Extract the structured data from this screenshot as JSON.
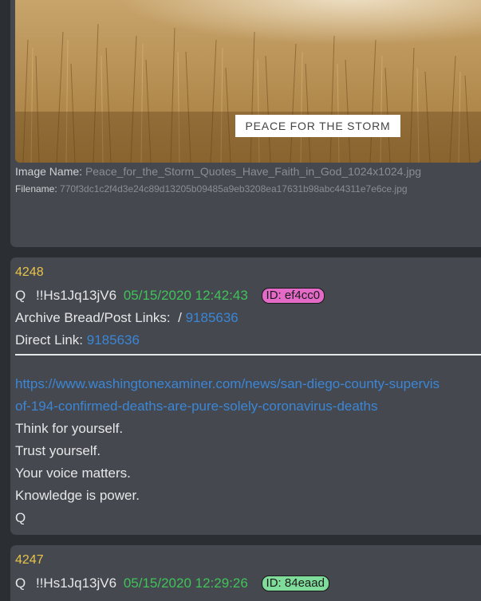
{
  "top_card": {
    "image_banner": "PEACE FOR THE STORM",
    "image_name_label": "Image Name:",
    "image_name_value": "Peace_for_the_Storm_Quotes_Have_Faith_in_God_1024x1024.jpg",
    "filename_label": "Filename:",
    "filename_value": "770f3dc1c2f4d3e24c89d13205b09485a9eb3208ea17631b98abc44311e7e6ce.jpg"
  },
  "post_4248": {
    "number": "4248",
    "author": "Q",
    "tripcode": "!!Hs1Jq13jV6",
    "datetime": "05/15/2020 12:42:43",
    "id_badge": "ID: ef4cc0",
    "id_color": "#e46ac8",
    "archive_label": "Archive Bread/Post Links:",
    "archive_sep": "/",
    "archive_link": "9185636",
    "direct_label": "Direct Link:",
    "direct_link": "9185636",
    "url_line1": "https://www.washingtonexaminer.com/news/san-diego-county-supervis",
    "url_line2": "of-194-confirmed-deaths-are-pure-solely-coronavirus-deaths",
    "body": [
      "Think for yourself.",
      "Trust yourself.",
      "Your voice matters.",
      "Knowledge is power.",
      "Q"
    ]
  },
  "post_4247": {
    "number": "4247",
    "author": "Q",
    "tripcode": "!!Hs1Jq13jV6",
    "datetime": "05/15/2020 12:29:26",
    "id_badge": "ID: 84eaad",
    "id_color": "#7fdc9a"
  }
}
